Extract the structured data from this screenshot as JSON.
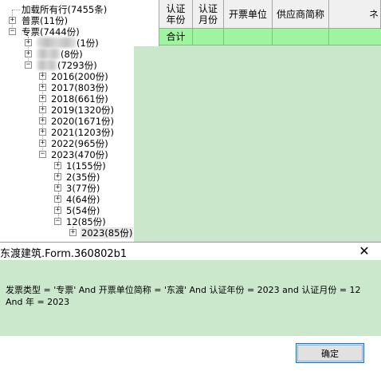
{
  "tree": {
    "nodes": [
      {
        "label": "加载所有行(7455条)",
        "expander": ""
      },
      {
        "label": "普票(11份)",
        "expander": "+"
      },
      {
        "label": "专票(7444份)",
        "expander": "−"
      },
      {
        "label": "(1份)",
        "expander": "+"
      },
      {
        "label": "(8份)",
        "expander": "+"
      },
      {
        "label": "(7293份)",
        "expander": "−"
      },
      {
        "label": "2016(200份)",
        "expander": "+"
      },
      {
        "label": "2017(803份)",
        "expander": "+"
      },
      {
        "label": "2018(661份)",
        "expander": "+"
      },
      {
        "label": "2019(1320份)",
        "expander": "+"
      },
      {
        "label": "2020(1671份)",
        "expander": "+"
      },
      {
        "label": "2021(1203份)",
        "expander": "+"
      },
      {
        "label": "2022(965份)",
        "expander": "+"
      },
      {
        "label": "2023(470份)",
        "expander": "−"
      },
      {
        "label": "1(155份)",
        "expander": "+"
      },
      {
        "label": "2(35份)",
        "expander": "+"
      },
      {
        "label": "3(77份)",
        "expander": "+"
      },
      {
        "label": "4(64份)",
        "expander": "+"
      },
      {
        "label": "5(54份)",
        "expander": "+"
      },
      {
        "label": "12(85份)",
        "expander": "−"
      },
      {
        "label": "2023(85份)",
        "expander": "+"
      }
    ]
  },
  "grid": {
    "headers": [
      "认证\n年份",
      "认证\n月份",
      "开票单位",
      "供应商简称",
      "ネ"
    ],
    "total_label": "合计"
  },
  "dialog": {
    "title": "东渡建筑.Form.360802b1",
    "close_symbol": "✕",
    "message_line1": "发票类型 = '专票' And 开票单位简称 = '东渡' And 认证年份 = 2023 and 认证月份 = 12",
    "message_line2": "And 年 = 2023",
    "ok_label": "确定"
  }
}
